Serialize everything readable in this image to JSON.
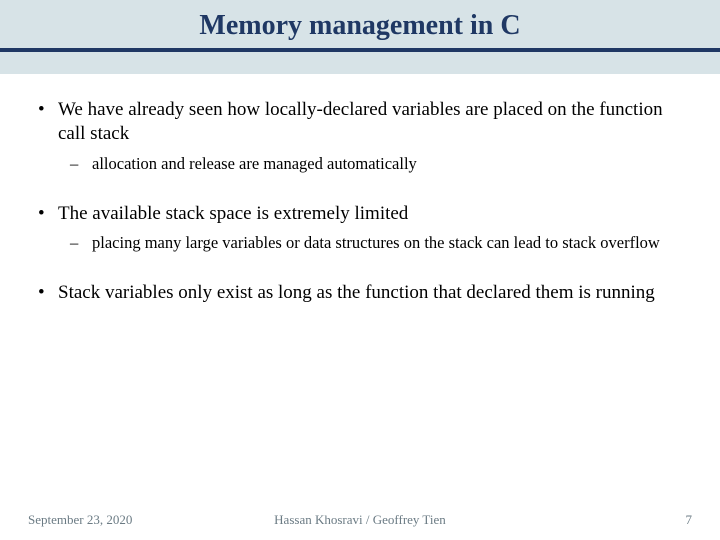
{
  "title": "Memory management in C",
  "bullets": {
    "b1": "We have already seen how locally-declared variables are placed on the function call stack",
    "b1_sub1": "allocation and release are managed automatically",
    "b2": "The available stack space is extremely limited",
    "b2_sub1": "placing many large variables or data structures on the stack can lead to stack overflow",
    "b3": "Stack variables only exist as long as the function that declared them is running"
  },
  "footer": {
    "date": "September 23, 2020",
    "authors": "Hassan Khosravi / Geoffrey Tien",
    "page": "7"
  }
}
